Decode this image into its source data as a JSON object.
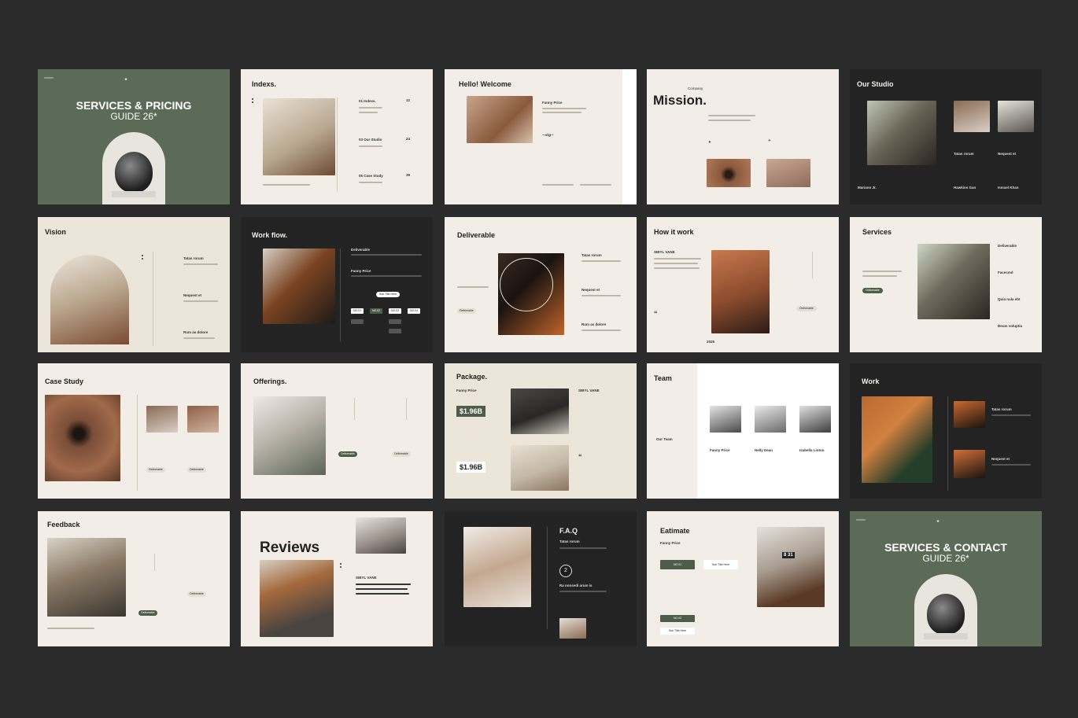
{
  "slides": {
    "s1": {
      "title": "SERVICES & PRICING",
      "subtitle": "GUIDE 26*"
    },
    "s2": {
      "title": "Indexs.",
      "items": [
        {
          "label": "01 Indexs.",
          "num": "12"
        },
        {
          "label": "03 Our Studio",
          "num": "24"
        },
        {
          "label": "05 Case Study",
          "num": "39"
        }
      ]
    },
    "s3": {
      "title": "Hello! Welcome",
      "name": "Fanny Price"
    },
    "s4": {
      "kicker": "Company",
      "title": "Mission."
    },
    "s5": {
      "title": "Our Studio",
      "names": [
        "Mariano Jr.",
        "Tatas rorum",
        "Hawkins Gan",
        "Nequest et",
        "Ismael Khan"
      ]
    },
    "s6": {
      "title": "Vision",
      "items": [
        "Tatas rorum",
        "Nequest et",
        "Rum as dolore"
      ]
    },
    "s7": {
      "title": "Work flow.",
      "labels": [
        "Deliverable",
        "Fanny Price",
        "Sub Title Here"
      ],
      "steps": [
        "NO.01",
        "NO.02",
        "NO.03",
        "NO.04"
      ]
    },
    "s8": {
      "title": "Deliverable",
      "items": [
        "Tatas rorum",
        "Nequest et",
        "Rum as dolore"
      ],
      "pill": "Deliverable"
    },
    "s9": {
      "title": "How it work",
      "brand": "SIBYL VANE",
      "pill": "Deliverable",
      "year": "2026"
    },
    "s10": {
      "title": "Services",
      "pill": "Deliverable",
      "items": [
        "Deliverable",
        "Facecmd",
        "Quia nula ebt",
        "Deum voluptia"
      ]
    },
    "s11": {
      "title": "Case Study",
      "pills": [
        "Deliverable",
        "Deliverable"
      ]
    },
    "s12": {
      "title": "Offerings.",
      "pills": [
        "Deliverable",
        "Deliverable"
      ]
    },
    "s13": {
      "title": "Package.",
      "label": "Fanny Price",
      "prices": [
        "$1.96B",
        "$1.96B"
      ],
      "brand": "SIBYL VANE"
    },
    "s14": {
      "title": "Team",
      "link": "Our Team",
      "members": [
        "Fanny Price",
        "Nelly Dean",
        "Isabella Linton"
      ]
    },
    "s15": {
      "title": "Work",
      "items": [
        "Tatas rorum",
        "Nequest et"
      ]
    },
    "s16": {
      "title": "Feedback",
      "pills": [
        "Deliverable",
        "Deliverable"
      ]
    },
    "s17": {
      "title": "Reviews",
      "brand": "SIBYL VANE"
    },
    "s18": {
      "title": "F.A.Q",
      "q1": "Tatas rorum",
      "num": "2",
      "q2": "Ra nonsedi arum is"
    },
    "s19": {
      "title": "Eatimate",
      "label": "Fanny Price",
      "buttons": [
        "NO.01",
        "Sub Title Here",
        "NO.02",
        "Sub Title Here"
      ],
      "clock": "8 31"
    },
    "s20": {
      "title": "SERVICES & CONTACT",
      "subtitle": "GUIDE 26*"
    }
  }
}
